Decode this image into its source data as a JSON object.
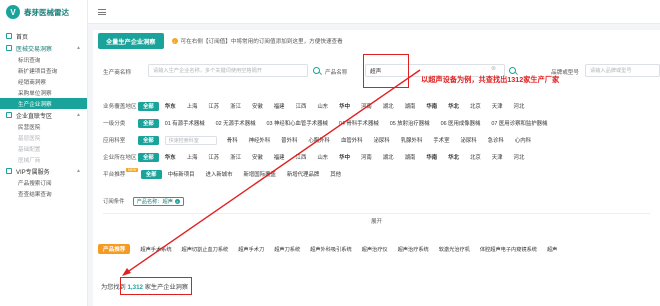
{
  "app": {
    "name": "春芽医械雷达"
  },
  "sidebar": {
    "groups": [
      {
        "label": "医械交易洞察",
        "items": [
          {
            "label": "标讯查询",
            "active": false,
            "muted": false
          },
          {
            "label": "新扩建项目查询",
            "active": false,
            "muted": false
          },
          {
            "label": "经销商洞察",
            "active": false,
            "muted": false
          },
          {
            "label": "采购单位洞察",
            "active": false,
            "muted": false
          },
          {
            "label": "生产企业洞察",
            "active": true,
            "muted": false
          }
        ]
      },
      {
        "label": "企业直联专区",
        "items": [
          {
            "label": "民营医院",
            "active": false,
            "muted": false
          },
          {
            "label": "基层医院",
            "active": false,
            "muted": true
          },
          {
            "label": "基础配置",
            "active": false,
            "muted": true
          },
          {
            "label": "医械厂商",
            "active": false,
            "muted": true
          }
        ]
      },
      {
        "label": "VIP专属服务",
        "items": [
          {
            "label": "产品搜索订阅",
            "active": false,
            "muted": false
          },
          {
            "label": "查查结果查询",
            "active": false,
            "muted": false
          }
        ]
      }
    ]
  },
  "header": {
    "tab_label": "全量生产企业洞察",
    "tip": "可在右侧【订阅值】中将常用的订阅值添加到这里，方便快速查看"
  },
  "search": {
    "company_label": "生产商名称",
    "company_placeholder": "请输入生产企业名称，多个关键词使用空格隔开",
    "product_label": "产品名称",
    "product_value": "超声",
    "model_label": "品牌或型号",
    "model_placeholder": "请输入品牌或型号"
  },
  "annotation": "以超声设备为例，共查找出1312家生产厂家",
  "filters": [
    {
      "label": "业务覆盖地区",
      "all": "全部",
      "options": [
        "华东",
        "上海",
        "江苏",
        "浙江",
        "安徽",
        "福建",
        "江西",
        "山东",
        "华中",
        "河南",
        "湖北",
        "湖南",
        "华南",
        "华北",
        "北京",
        "天津",
        "河北"
      ]
    },
    {
      "label": "一级分类",
      "all": "全部",
      "options": [
        "01 有源手术器械",
        "02 无源手术器械",
        "03 神经和心血管手术器械",
        "04 骨科手术器械",
        "05 放射治疗器械",
        "06 医用成像器械",
        "07 医用诊察和监护器械"
      ]
    },
    {
      "label": "应用科室",
      "all": "全部",
      "search_placeholder": "快速检索科室",
      "options": [
        "骨科",
        "神经外科",
        "普外科",
        "心胸外科",
        "血管外科",
        "泌尿科",
        "乳腺外科",
        "手术室",
        "泌尿科",
        "急诊科",
        "心内科"
      ]
    },
    {
      "label": "企业所在地区",
      "all": "全部",
      "options": [
        "华东",
        "上海",
        "江苏",
        "浙江",
        "安徽",
        "福建",
        "江西",
        "山东",
        "华中",
        "河南",
        "湖北",
        "湖南",
        "华南",
        "华北",
        "北京",
        "天津",
        "河北"
      ]
    },
    {
      "label": "平台推荐",
      "badge": "NEW",
      "all": "全部",
      "options": [
        "中标新项目",
        "进入新城市",
        "新增国际覆盖",
        "新增代理品牌",
        "其他"
      ]
    }
  ],
  "conditions": {
    "label": "订阅条件",
    "tag": "产品名称：超声"
  },
  "expand_label": "展开",
  "products": {
    "tag": "产品推荐",
    "items": [
      "超声手术系统",
      "超声切割止血刀系统",
      "超声手术刀",
      "超声刀系统",
      "超声外科吸引系统",
      "超声治疗仪",
      "超声治疗系统",
      "软激光治疗机",
      "体腔超声电子内窥镜系统",
      "超声"
    ]
  },
  "result": {
    "prefix": "为您找到",
    "count": "1,312",
    "suffix": "家生产企业洞察"
  },
  "colors": {
    "primary": "#1aa39a",
    "annotation": "#e02020",
    "orange": "#f59a23"
  }
}
